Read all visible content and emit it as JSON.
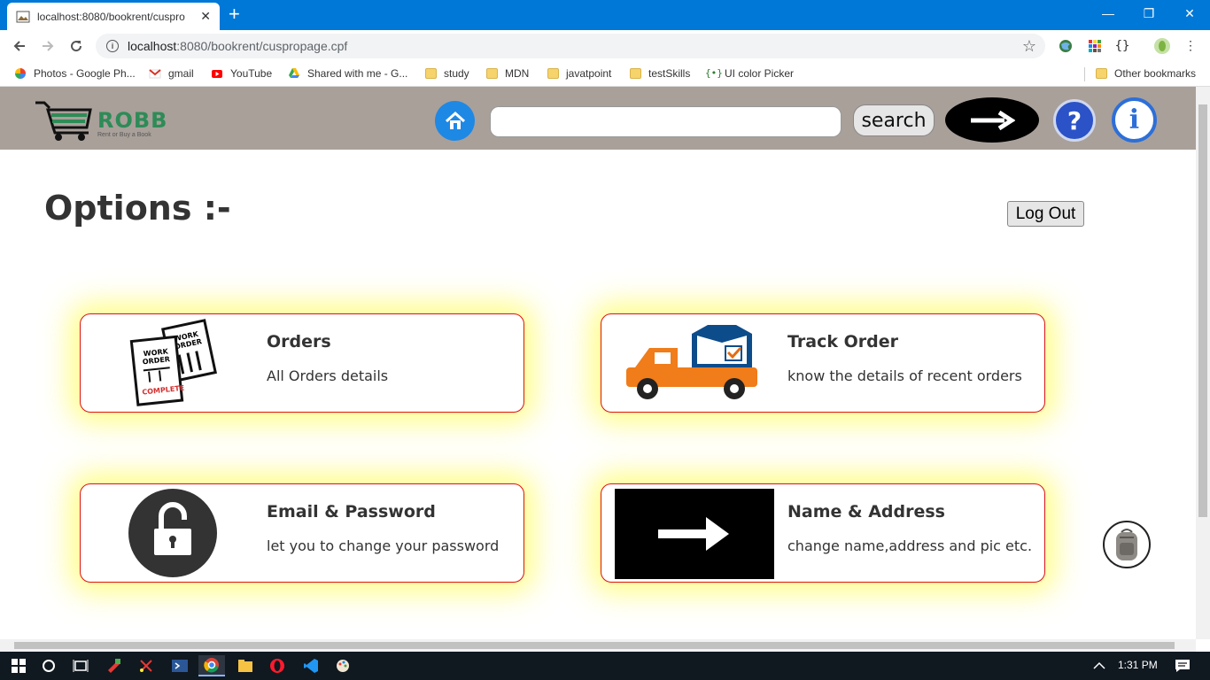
{
  "browser": {
    "tab_title": "localhost:8080/bookrent/cuspro",
    "new_tab_symbol": "+",
    "close_symbol": "✕",
    "url_host": "localhost",
    "url_rest": ":8080/bookrent/cuspropage.cpf",
    "window_controls": [
      "—",
      "❐",
      "✕"
    ]
  },
  "bookmarks": [
    {
      "label": "Photos - Google Ph...",
      "icon": "photos-icon"
    },
    {
      "label": "gmail",
      "icon": "gmail-icon"
    },
    {
      "label": "YouTube",
      "icon": "youtube-icon"
    },
    {
      "label": "Shared with me - G...",
      "icon": "drive-icon"
    },
    {
      "label": "study",
      "icon": "folder-icon"
    },
    {
      "label": "MDN",
      "icon": "folder-icon"
    },
    {
      "label": "javatpoint",
      "icon": "folder-icon"
    },
    {
      "label": "testSkills",
      "icon": "folder-icon"
    },
    {
      "label": "UI color Picker",
      "icon": "picker-icon"
    }
  ],
  "other_bookmarks": "Other bookmarks",
  "header": {
    "logo_text": "ROBB",
    "logo_tagline": "Rent or Buy a Book",
    "search_value": "",
    "search_label": "search",
    "help_symbol": "?",
    "about_symbol": "i"
  },
  "main": {
    "title": "Options :-",
    "logout_label": "Log Out"
  },
  "cards": [
    {
      "title": "Orders",
      "desc": "All Orders details",
      "icon": "work-order-icon"
    },
    {
      "title": "Track Order",
      "desc": "know the details of recent orders",
      "icon": "delivery-truck-icon"
    },
    {
      "title": "Email & Password",
      "desc": "let you to change your password",
      "icon": "unlock-icon"
    },
    {
      "title": "Name & Address",
      "desc": "change name,address and pic etc.",
      "icon": "arrow-right-icon"
    }
  ],
  "taskbar": {
    "time": "1:31 PM"
  },
  "colors": {
    "header_bg": "#a9a09a",
    "card_border": "#dd1111",
    "card_glow": "#fffc64",
    "titlebar": "#0078d7"
  }
}
